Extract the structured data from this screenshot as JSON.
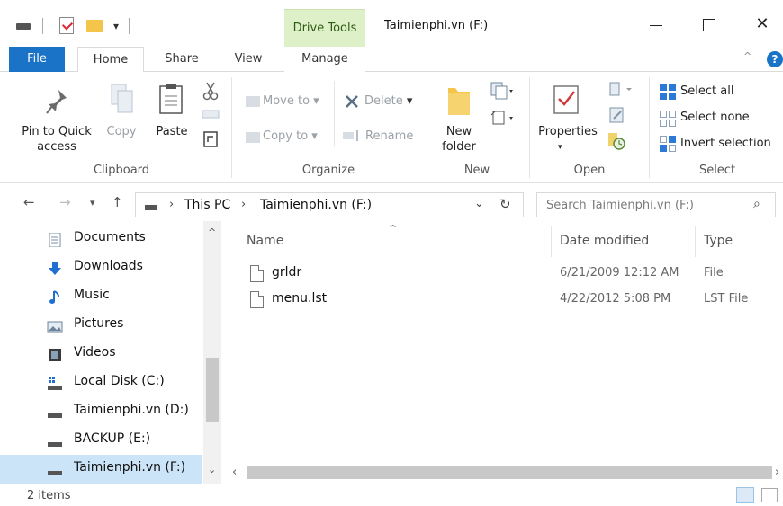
{
  "window": {
    "context_tab": "Drive Tools",
    "title": "Taimienphi.vn (F:)",
    "close_glyph": "✕"
  },
  "tabs": {
    "file": "File",
    "home": "Home",
    "share": "Share",
    "view": "View",
    "manage": "Manage"
  },
  "ribbon": {
    "clipboard": {
      "pin_label_1": "Pin to Quick",
      "pin_label_2": "access",
      "copy": "Copy",
      "paste": "Paste",
      "group": "Clipboard"
    },
    "organize": {
      "move_to": "Move to",
      "copy_to": "Copy to",
      "delete": "Delete",
      "rename": "Rename",
      "group": "Organize"
    },
    "new": {
      "folder_1": "New",
      "folder_2": "folder",
      "group": "New"
    },
    "open": {
      "properties": "Properties",
      "group": "Open"
    },
    "select": {
      "all": "Select all",
      "none": "Select none",
      "invert": "Invert selection",
      "group": "Select"
    }
  },
  "address": {
    "root": "This PC",
    "location": "Taimienphi.vn (F:)",
    "separator": "›"
  },
  "search": {
    "placeholder": "Search Taimienphi.vn (F:)"
  },
  "nav_items": [
    {
      "label": "Documents",
      "icon": "documents-icon"
    },
    {
      "label": "Downloads",
      "icon": "downloads-icon"
    },
    {
      "label": "Music",
      "icon": "music-icon"
    },
    {
      "label": "Pictures",
      "icon": "pictures-icon"
    },
    {
      "label": "Videos",
      "icon": "videos-icon"
    },
    {
      "label": "Local Disk (C:)",
      "icon": "local-disk-icon"
    },
    {
      "label": "Taimienphi.vn (D:)",
      "icon": "drive-icon"
    },
    {
      "label": "BACKUP (E:)",
      "icon": "drive-icon"
    },
    {
      "label": "Taimienphi.vn (F:)",
      "icon": "drive-icon",
      "selected": true
    }
  ],
  "columns": {
    "name": "Name",
    "date": "Date modified",
    "type": "Type"
  },
  "files": [
    {
      "name": "grldr",
      "date": "6/21/2009 12:12 AM",
      "type": "File"
    },
    {
      "name": "menu.lst",
      "date": "4/22/2012 5:08 PM",
      "type": "LST File"
    }
  ],
  "status": {
    "count": "2 items"
  },
  "colors": {
    "accent": "#1a73c6",
    "drive_tools_bg": "#ddf0c8",
    "selected_bg": "#cce4f7"
  }
}
